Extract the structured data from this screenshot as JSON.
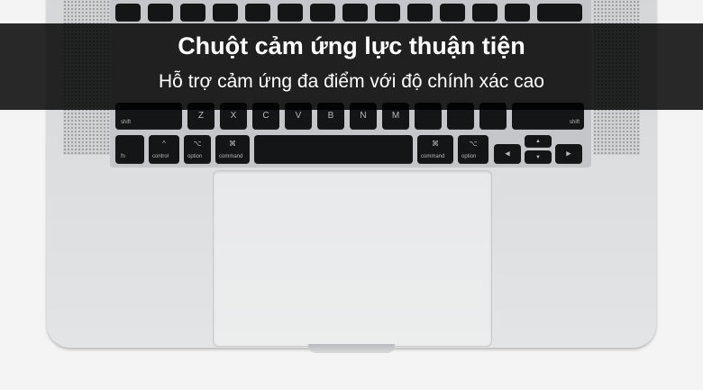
{
  "banner": {
    "title": "Chuột cảm ứng lực thuận tiện",
    "subtitle": "Hỗ trợ cảm ứng đa điểm với độ chính xác cao"
  },
  "keyboard": {
    "shift_left": "shift",
    "z": "Z",
    "x": "X",
    "c": "C",
    "v": "V",
    "b": "B",
    "n": "N",
    "m": "M",
    "shift_right": "shift",
    "fn": "fn",
    "control": "control",
    "option_left": "option",
    "command_left": "command",
    "command_right": "command",
    "option_right": "option"
  }
}
